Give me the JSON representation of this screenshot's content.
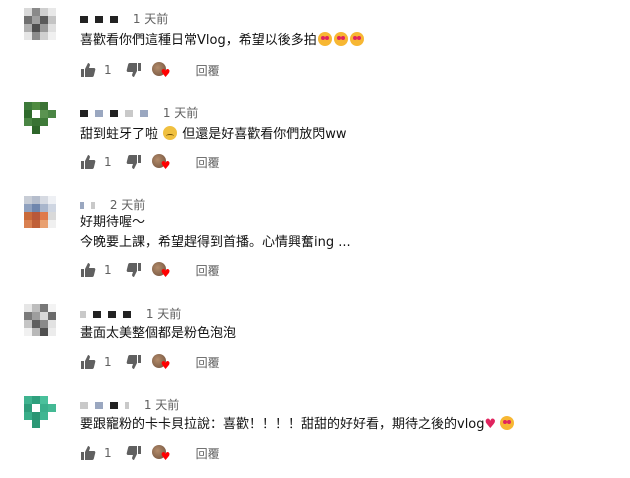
{
  "comments": [
    {
      "time": "1 天前",
      "text": "喜歡看你們這種日常Vlog，希望以後多拍",
      "likes": "1",
      "reply": "回覆",
      "emoji_after": [
        "heart-eyes",
        "heart-eyes",
        "heart-eyes"
      ]
    },
    {
      "time": "1 天前",
      "text_a": "甜到蛀牙了啦",
      "text_b": "但還是好喜歡看你們放閃ww",
      "likes": "1",
      "reply": "回覆"
    },
    {
      "time": "2 天前",
      "line1": "好期待喔～",
      "line2": "今晚要上課，希望趕得到首播。心情興奮ing ...",
      "likes": "1",
      "reply": "回覆"
    },
    {
      "time": "1 天前",
      "text": "畫面太美整個都是粉色泡泡",
      "likes": "1",
      "reply": "回覆"
    },
    {
      "time": "1 天前",
      "text": "要跟寵粉的卡卡貝拉說：喜歡！！！！甜甜的好好看，期待之後的vlog",
      "likes": "1",
      "reply": "回覆"
    }
  ],
  "colors": {
    "creator_heart": "#ff0000",
    "meta_text": "#606060"
  }
}
